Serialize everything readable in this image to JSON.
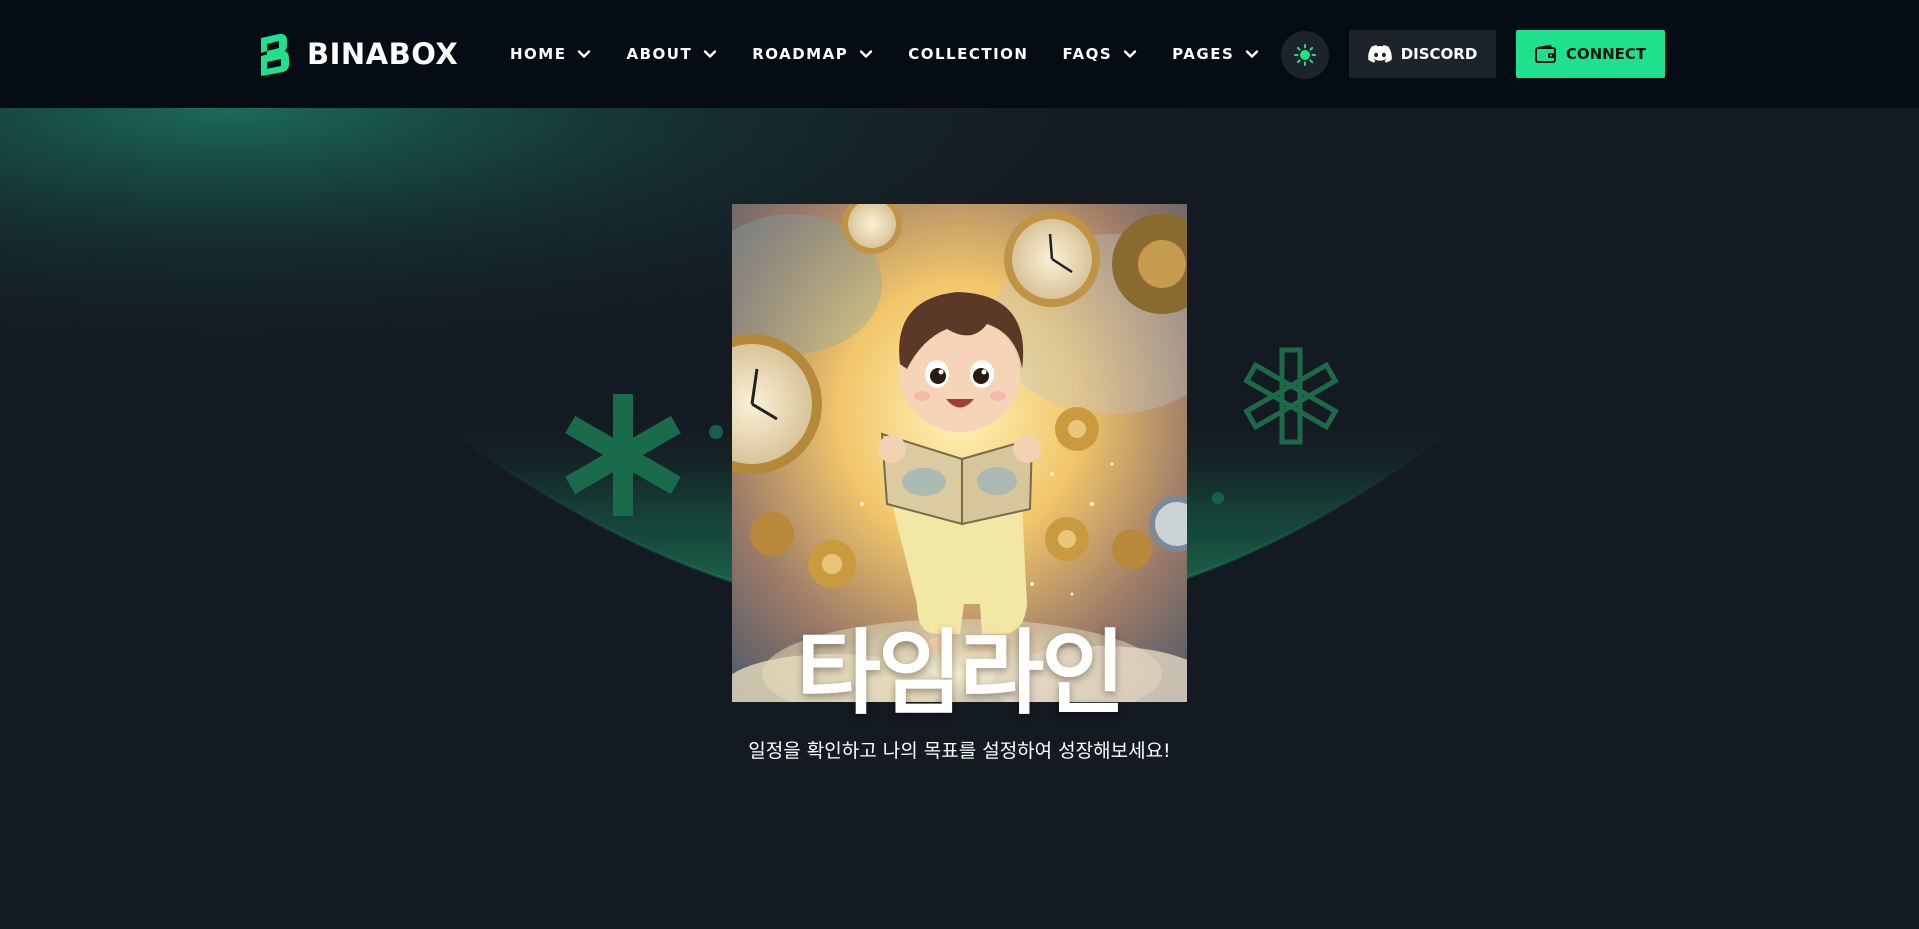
{
  "brand": {
    "name": "BINABOX",
    "accent_color": "#1fe08d"
  },
  "nav": {
    "items": [
      {
        "label": "HOME",
        "has_dropdown": true
      },
      {
        "label": "ABOUT",
        "has_dropdown": true
      },
      {
        "label": "ROADMAP",
        "has_dropdown": true
      },
      {
        "label": "COLLECTION",
        "has_dropdown": false
      },
      {
        "label": "FAQS",
        "has_dropdown": true
      },
      {
        "label": "PAGES",
        "has_dropdown": true
      }
    ]
  },
  "header_actions": {
    "theme_toggle_icon": "sun-icon",
    "discord_label": "DISCORD",
    "connect_label": "CONNECT"
  },
  "hero": {
    "title": "타임라인",
    "subtitle": "일정을 확인하고 나의 목표를 설정하여 성장해보세요!",
    "image_subject": "cartoon child reading a book surrounded by clocks and gears"
  }
}
